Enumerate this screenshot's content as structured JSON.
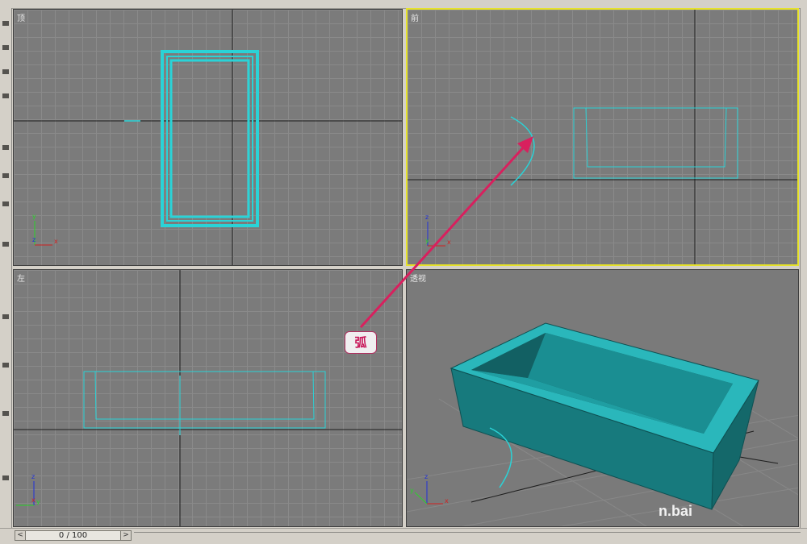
{
  "viewports": {
    "top": {
      "label": "顶"
    },
    "front": {
      "label": "前"
    },
    "left": {
      "label": "左"
    },
    "perspective": {
      "label": "透视"
    }
  },
  "axis_labels": {
    "x": "x",
    "y": "y",
    "z": "z"
  },
  "annotation": {
    "text": "弧"
  },
  "time_slider": {
    "label": "0 / 100",
    "prev": "<",
    "next": ">"
  },
  "watermark": {
    "text": "n.bai"
  },
  "colors": {
    "viewport_bg": "#7b7b7b",
    "grid": "#8a8a8a",
    "object": "#2ad3d7",
    "active_border": "#e6e22b",
    "annotation_arrow": "#d8205e"
  }
}
